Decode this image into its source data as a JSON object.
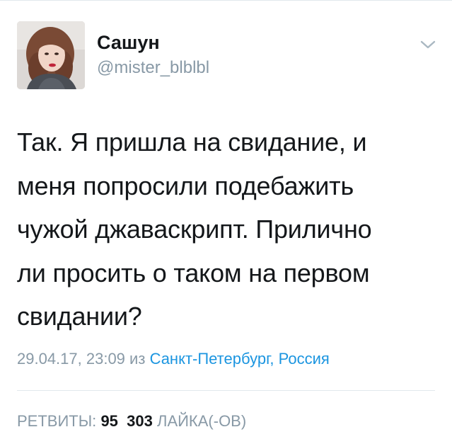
{
  "tweet": {
    "author": {
      "display_name": "Сашун",
      "username": "@mister_blblbl",
      "avatar_icon": "user-avatar-photo"
    },
    "menu_icon": "chevron-down-icon",
    "text_lines": [
      "Так. Я пришла на свидание, и",
      "меня попросили подебажить",
      "чужой джаваскрипт. Прилично",
      "ли просить о таком на первом",
      "свидании?"
    ],
    "meta": {
      "date": "29.04.17, 23:09",
      "from_word": "из",
      "location": "Санкт-Петербург, Россия"
    },
    "stats": {
      "retweets_label": "РЕТВИТЫ:",
      "retweets_count": "95",
      "likes_count": "303",
      "likes_label": "ЛАЙКА(-ОВ)"
    },
    "colors": {
      "text": "#14171a",
      "secondary": "#8899a6",
      "link": "#1b95e0",
      "border": "#e1e8ed"
    }
  }
}
